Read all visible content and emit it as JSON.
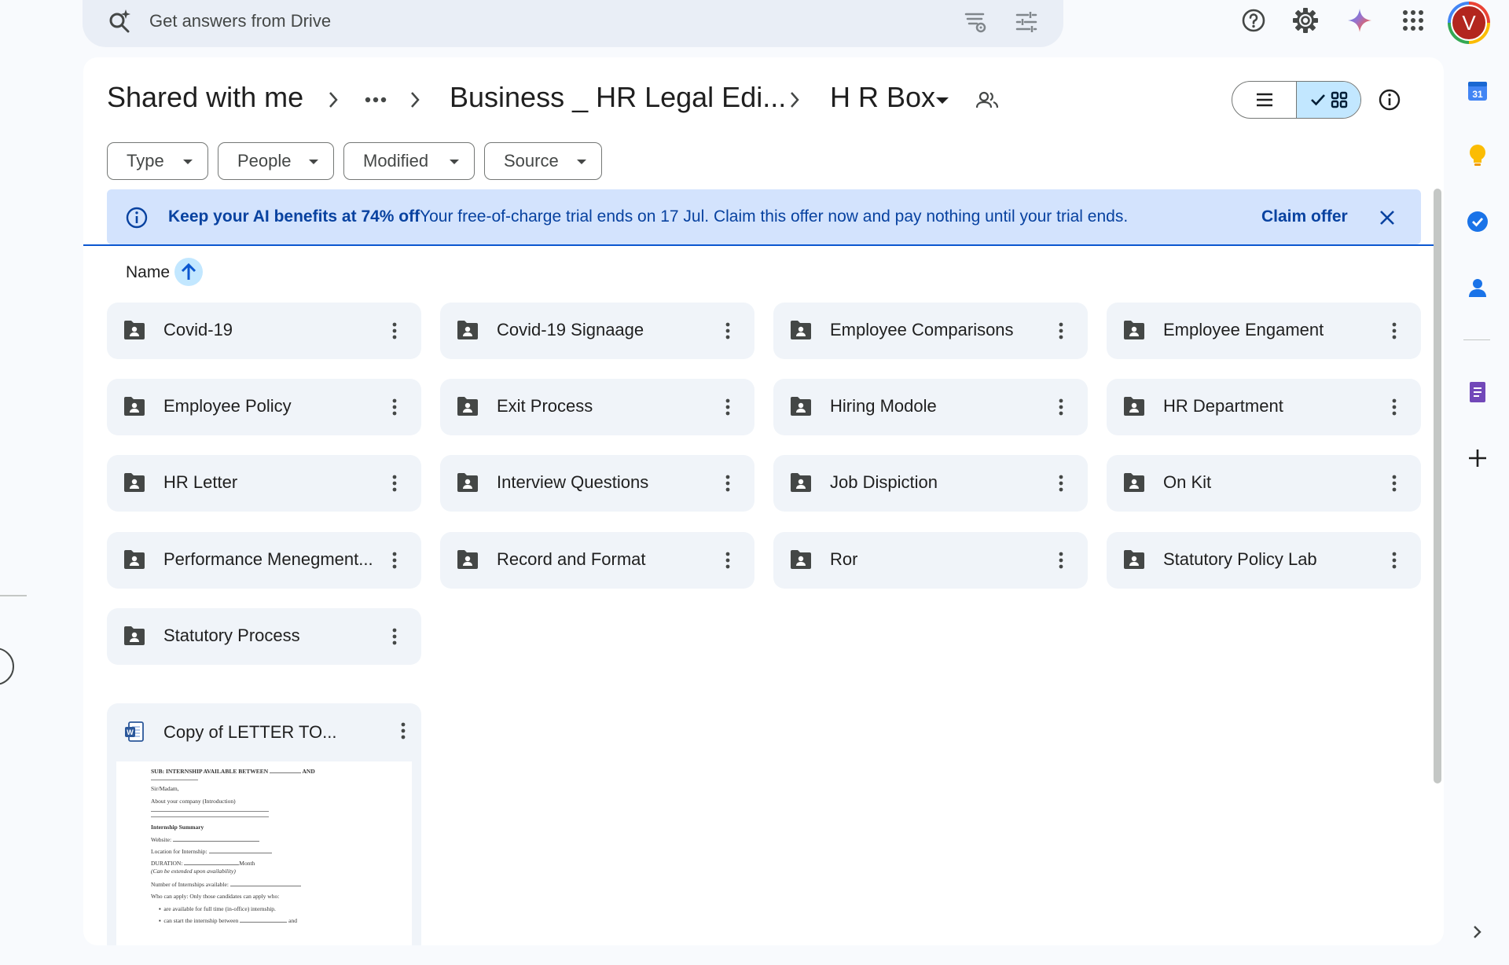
{
  "search": {
    "placeholder": "Get answers from Drive",
    "icons": [
      "search-spark-icon",
      "search-filter-settings-icon",
      "tune-icon"
    ]
  },
  "topbar": {
    "icons": [
      "help-icon",
      "settings-icon",
      "gemini-icon",
      "apps-grid-icon"
    ],
    "avatar_letter": "V"
  },
  "breadcrumb": {
    "items": [
      "Shared with me",
      "Business _ HR Legal Edi...",
      "H R Box"
    ],
    "overflow_icon": "more-horiz-icon",
    "shared_icon": "shared-people-icon"
  },
  "view": {
    "list_icon": "list-view-icon",
    "grid_icon": "grid-view-icon",
    "selected": "grid",
    "info_icon": "info-icon"
  },
  "filters": [
    "Type",
    "People",
    "Modified",
    "Source"
  ],
  "banner": {
    "bold": "Keep your AI benefits at 74% off",
    "text": "Your free-of-charge trial ends on 17 Jul. Claim this offer now and pay nothing until your trial ends.",
    "cta": "Claim offer",
    "colors": {
      "background": "#d3e3fd",
      "text": "#0842a0"
    }
  },
  "list_header": {
    "name": "Name",
    "sort": "ascending"
  },
  "folders": [
    "Covid-19",
    "Covid-19 Signaage",
    "Employee Comparisons",
    "Employee Engament",
    "Employee Policy",
    "Exit Process",
    "Hiring Modole",
    "HR Department",
    "HR Letter",
    "Interview Questions",
    "Job Dispiction",
    "On Kit",
    "Performance Menegment...",
    "Record and Format",
    "Ror",
    "Statutory Policy Lab",
    "Statutory Process"
  ],
  "files": [
    {
      "name": "Copy of LETTER TO...",
      "icon": "word-doc-icon",
      "preview": {
        "subject": "SUB: INTERNSHIP AVAILABLE BETWEEN",
        "subject_and": "AND",
        "greeting": "Sir/Madam,",
        "about": "About your company (Introduction)",
        "summary_title": "Internship Summary",
        "website": "Website:",
        "location": "Location for Internship:",
        "duration": "DURATION:",
        "duration_unit": "Month",
        "duration_note": "(Can be extended upon availability)",
        "number": "Number of Internships available:",
        "who": "Who can apply: Only those candidates can apply who:",
        "bullet1": "are available for full time (in-office) internship.",
        "bullet2": "can start the internship between",
        "bullet2_and": "and"
      }
    }
  ],
  "side_panel": {
    "icons": [
      "calendar-icon",
      "keep-icon",
      "tasks-icon",
      "contacts-icon",
      "forms-icon",
      "add-icon",
      "chevron-right-icon"
    ],
    "calendar_day": "31"
  }
}
